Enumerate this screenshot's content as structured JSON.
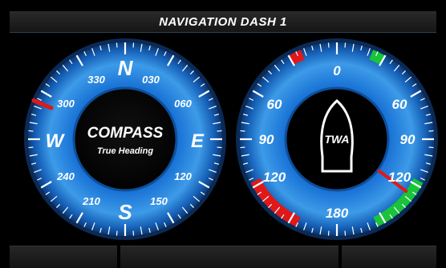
{
  "title": "NAVIGATION DASH 1",
  "colors": {
    "accent": "#1e90ff",
    "dial_light": "#4aa3ee",
    "dial_dark": "#0a3f7a",
    "port_red": "#e01818",
    "stbd_green": "#19c43a"
  },
  "compass": {
    "title": "COMPASS",
    "subtitle": "True Heading",
    "cardinals": {
      "n": "N",
      "e": "E",
      "s": "S",
      "w": "W"
    },
    "degree_labels": [
      "030",
      "060",
      "120",
      "150",
      "210",
      "240",
      "300",
      "330"
    ],
    "heading_deg": 293
  },
  "wind": {
    "title": "TWA",
    "top": "0",
    "bottom": "180",
    "left": [
      "60",
      "90",
      "120"
    ],
    "right": [
      "60",
      "90",
      "120"
    ],
    "angle_deg": 127
  },
  "bottom_tabs": [
    "",
    "",
    ""
  ]
}
